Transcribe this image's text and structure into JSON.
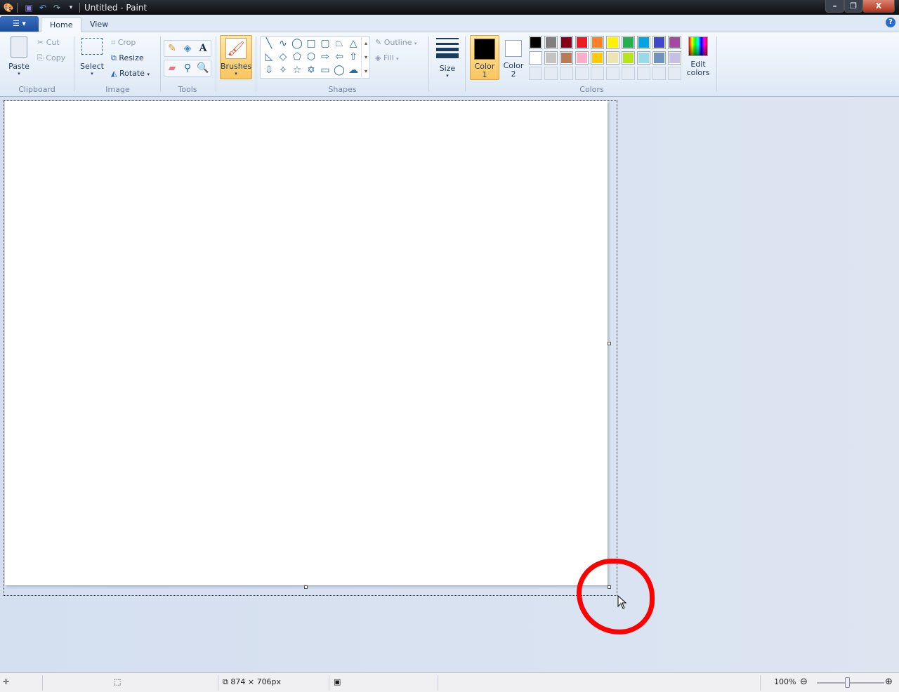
{
  "window": {
    "title": "Untitled - Paint",
    "controls": {
      "minimize": "–",
      "restore": "❐",
      "close": "X"
    }
  },
  "quick_access": {
    "icons": [
      "paint-app-icon",
      "save-icon",
      "undo-icon",
      "redo-icon",
      "customize-dropdown-icon"
    ]
  },
  "tabs": [
    {
      "label": "Home",
      "active": true
    },
    {
      "label": "View",
      "active": false
    }
  ],
  "ribbon": {
    "clipboard": {
      "group": "Clipboard",
      "paste": "Paste",
      "cut": "Cut",
      "copy": "Copy"
    },
    "image": {
      "group": "Image",
      "select": "Select",
      "crop": "Crop",
      "resize": "Resize",
      "rotate": "Rotate"
    },
    "tools": {
      "group": "Tools"
    },
    "brushes": {
      "label": "Brushes"
    },
    "shapes": {
      "group": "Shapes",
      "outline": "Outline",
      "fill": "Fill"
    },
    "size": {
      "label": "Size"
    },
    "colors": {
      "group": "Colors",
      "color1": "Color",
      "color1_num": "1",
      "color2": "Color",
      "color2_num": "2",
      "edit": "Edit",
      "edit2": "colors",
      "color1_value": "#000000",
      "color2_value": "#ffffff",
      "palette_row1": [
        "#000000",
        "#7f7f7f",
        "#880015",
        "#ed1c24",
        "#ff7f27",
        "#fff200",
        "#22b14c",
        "#00a2e8",
        "#3f48cc",
        "#a349a4"
      ],
      "palette_row2": [
        "#ffffff",
        "#c3c3c3",
        "#b97a57",
        "#ffaec9",
        "#ffc90e",
        "#efe4b0",
        "#b5e61d",
        "#99d9ea",
        "#7092be",
        "#c8bfe7"
      ]
    }
  },
  "status": {
    "canvas_size": "874 × 706px",
    "zoom": "100%"
  },
  "accent": {
    "annotation": "#ff0000",
    "selected": "#fbd27a"
  }
}
